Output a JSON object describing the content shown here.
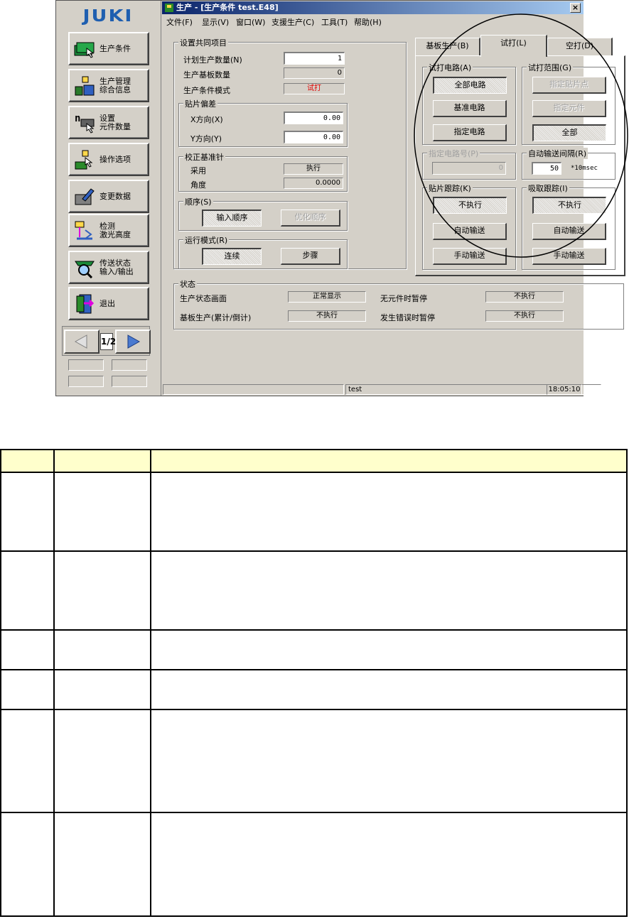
{
  "sidebar": {
    "logo": "JUKI",
    "buttons": [
      {
        "label": "生产条件",
        "icon": "production-condition-icon"
      },
      {
        "label": "生产管理\n综合信息",
        "icon": "production-management-icon"
      },
      {
        "label": "设置\n元件数量",
        "icon": "component-count-icon"
      },
      {
        "label": "操作选项",
        "icon": "operation-option-icon"
      },
      {
        "label": "变更数据",
        "icon": "change-data-icon"
      },
      {
        "label": "检测\n激光高度",
        "icon": "laser-height-icon"
      },
      {
        "label": "传送状态\n输入/输出",
        "icon": "transfer-status-icon"
      },
      {
        "label": "退出",
        "icon": "exit-door-icon"
      }
    ],
    "page": "1/2"
  },
  "window": {
    "title": "生产 - [生产条件 test.E48]",
    "close": "×",
    "menu": [
      "文件(F)",
      "显示(V)",
      "窗口(W)",
      "支援生产(C)",
      "工具(T)",
      "帮助(H)"
    ]
  },
  "common": {
    "title": "设置共同项目",
    "plan_label": "计划生产数量(N)",
    "plan_value": "1",
    "boards_label": "生产基板数量",
    "boards_value": "0",
    "mode_label": "生产条件模式",
    "mode_value": "试打",
    "offset_title": "贴片偏差",
    "x_label": "X方向(X)",
    "x_value": "0.00",
    "y_label": "Y方向(Y)",
    "y_value": "0.00",
    "pin_title": "校正基准针",
    "adopt_label": "采用",
    "adopt_value": "执行",
    "angle_label": "角度",
    "angle_value": "0.0000",
    "order_title": "顺序(S)",
    "order_input": "输入顺序",
    "order_opt": "优化顺序",
    "run_title": "运行模式(R)",
    "run_cont": "连续",
    "run_step": "步骤"
  },
  "tabs": [
    "基板生产(B)",
    "试打(L)",
    "空打(D)"
  ],
  "trial": {
    "circuit_title": "试打电路(A)",
    "all_circuit": "全部电路",
    "base_circuit": "基准电路",
    "spec_circuit": "指定电路",
    "range_title": "试打范围(G)",
    "spec_point": "指定贴片点",
    "spec_comp": "指定元件",
    "all": "全部",
    "circuit_no_title": "指定电路号(P)",
    "circuit_no": "0",
    "interval_title": "自动输送间隔(R)",
    "interval_value": "50",
    "interval_unit": "*10msec",
    "place_track_title": "贴片跟踪(K)",
    "pick_track_title": "吸取跟踪(I)",
    "no_exec": "不执行",
    "auto_feed": "自动输送",
    "manual_feed": "手动输送"
  },
  "status": {
    "title": "状态",
    "screen_label": "生产状态画面",
    "screen_value": "正常显示",
    "nopart_label": "无元件时暂停",
    "nopart_value": "不执行",
    "cum_label": "基板生产(累计/倒计)",
    "cum_value": "不执行",
    "err_label": "发生错误时暂停",
    "err_value": "不执行"
  },
  "statusbar": {
    "file": "test",
    "time": "18:05:10"
  }
}
